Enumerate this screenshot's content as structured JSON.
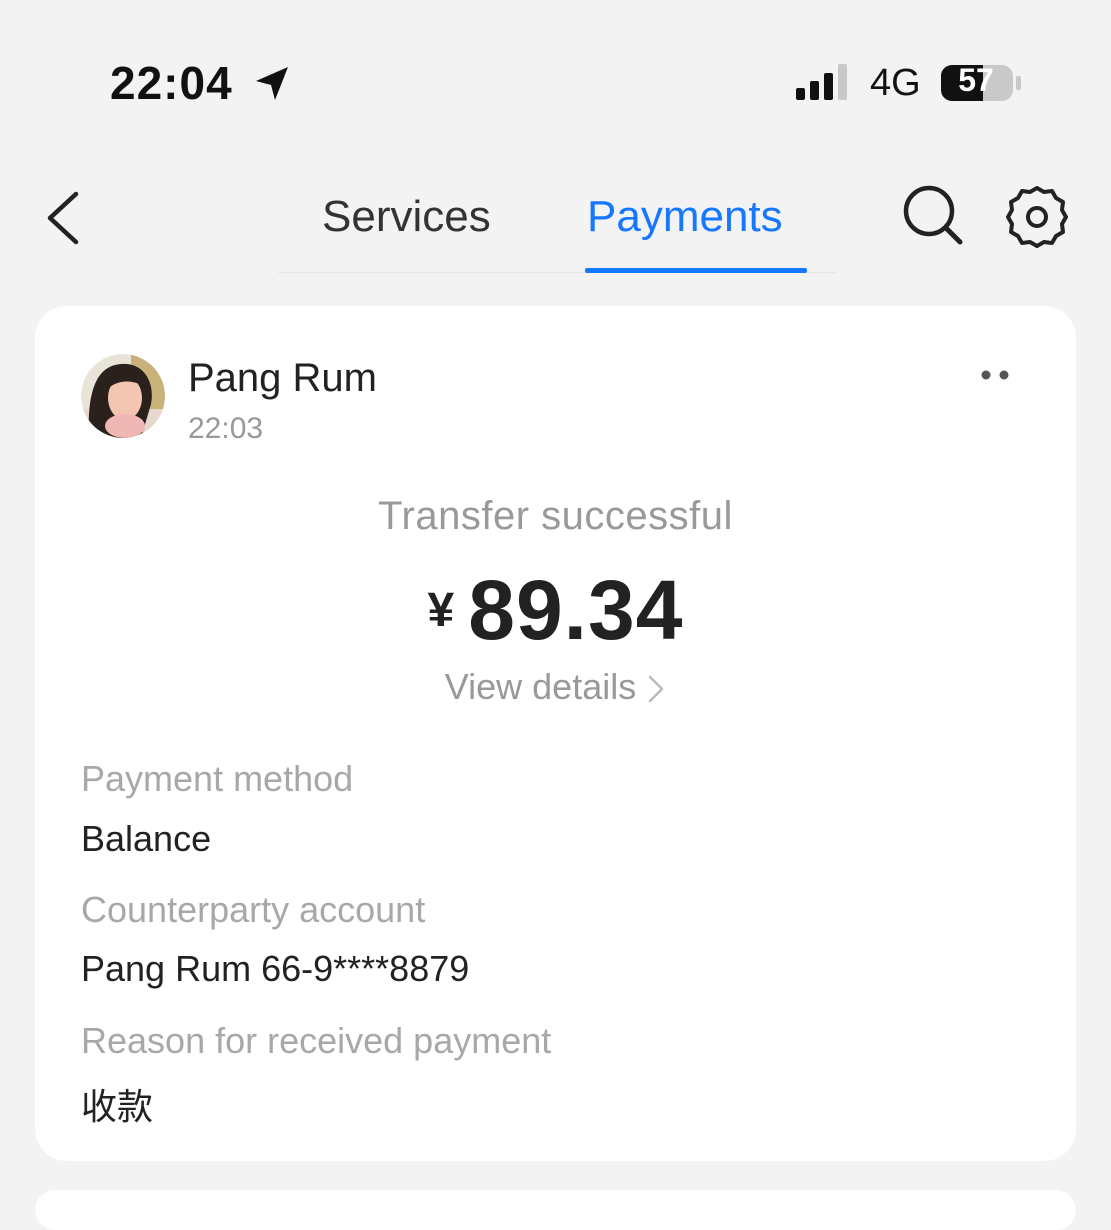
{
  "status_bar": {
    "time": "22:04",
    "network": "4G",
    "battery": "57",
    "icons": [
      "location-arrow-icon",
      "signal-icon",
      "battery-icon"
    ]
  },
  "header": {
    "tabs": [
      {
        "label": "Services",
        "active": false
      },
      {
        "label": "Payments",
        "active": true
      }
    ],
    "icons": [
      "back-chevron-icon",
      "search-icon",
      "gear-icon"
    ],
    "accent_color": "#1677ff"
  },
  "card": {
    "sender_name": "Pang Rum",
    "message_time": "22:03",
    "status": "Transfer successful",
    "currency": "¥",
    "amount": "89.34",
    "view_details": "View details",
    "fields": [
      {
        "label": "Payment method",
        "value": "Balance"
      },
      {
        "label": "Counterparty account",
        "value": "Pang Rum 66-9****8879"
      },
      {
        "label": "Reason for received payment",
        "value": "收款"
      }
    ]
  }
}
